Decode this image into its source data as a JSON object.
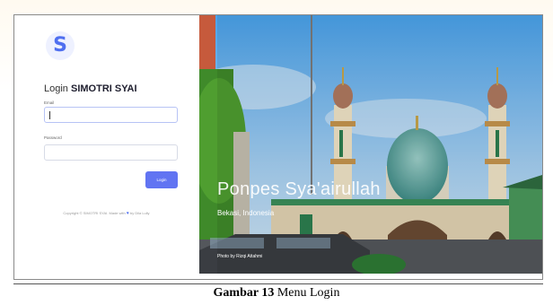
{
  "login": {
    "logo_letter": "S",
    "title_prefix": "Login",
    "title_app": "SIMOTRI SYAI",
    "email_label": "Email",
    "email_value": "",
    "password_label": "Password",
    "password_value": "",
    "button_label": "Login",
    "footer_before": "Copyright © SIMOTRI SYAI. Made with",
    "footer_after": "by Dila Lully"
  },
  "hero": {
    "title": "Ponpes Sya'airullah",
    "subtitle": "Bekasi, Indonesia",
    "credit": "Photo by Rizqi Attahmi"
  },
  "caption": {
    "label": "Gambar 13",
    "text": "Menu Login"
  },
  "colors": {
    "accent": "#6174f2",
    "sky_top": "#4aa3ec",
    "dome_teal": "#5aa5a0"
  }
}
